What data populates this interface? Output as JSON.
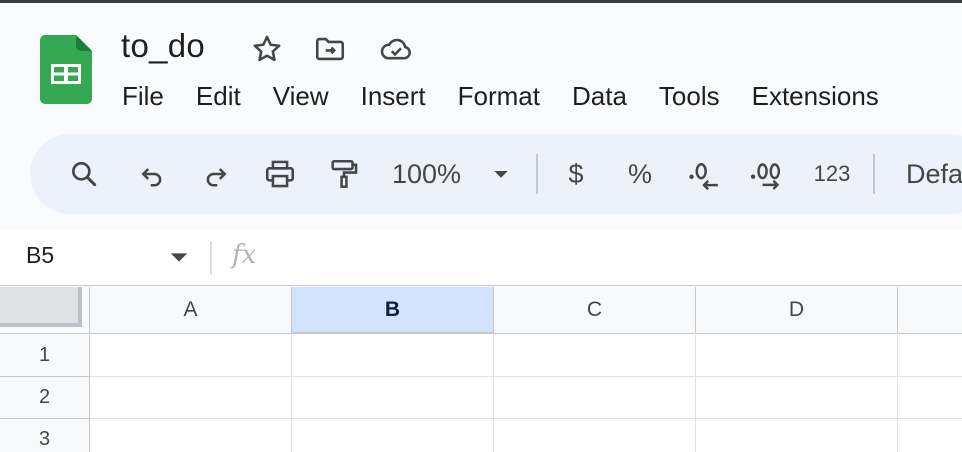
{
  "document": {
    "title": "to_do"
  },
  "menubar": {
    "items": [
      "File",
      "Edit",
      "View",
      "Insert",
      "Format",
      "Data",
      "Tools",
      "Extensions"
    ]
  },
  "toolbar": {
    "zoom": "100%",
    "currency_symbol": "$",
    "percent_symbol": "%",
    "more_formats_label": "123",
    "font_label_partial": "Defa"
  },
  "formula_bar": {
    "cell_reference": "B5",
    "fx_label": "fx",
    "value": ""
  },
  "grid": {
    "columns": [
      "A",
      "B",
      "C",
      "D"
    ],
    "rows": [
      "1",
      "2",
      "3"
    ],
    "selected_column": "B"
  },
  "colors": {
    "sheets_green": "#0f9d58",
    "selection_blue": "#d3e3fd",
    "toolbar_bg": "#edf2fa"
  }
}
